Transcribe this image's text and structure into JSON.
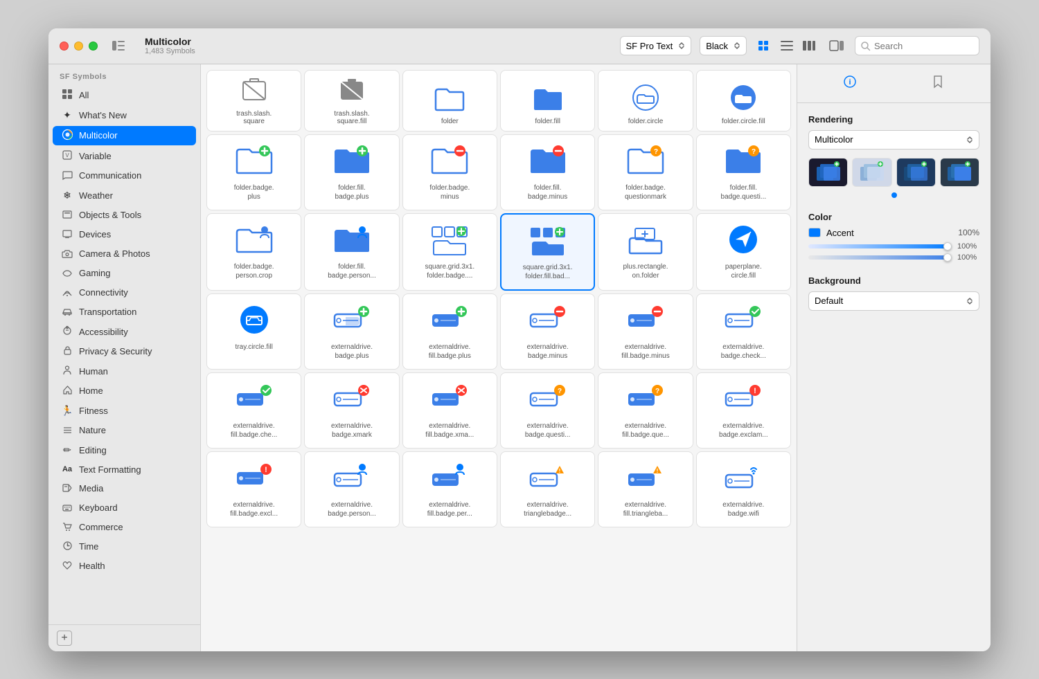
{
  "window": {
    "title": "Multicolor",
    "subtitle": "1,483 Symbols"
  },
  "toolbar": {
    "font": "SF Pro Text",
    "weight": "Black",
    "search_placeholder": "Search",
    "sidebar_toggle_label": "Toggle Sidebar"
  },
  "sidebar": {
    "header": "SF Symbols",
    "items": [
      {
        "id": "all",
        "label": "All",
        "icon": "⊞"
      },
      {
        "id": "whats-new",
        "label": "What's New",
        "icon": "✦"
      },
      {
        "id": "multicolor",
        "label": "Multicolor",
        "icon": "🌐",
        "active": true
      },
      {
        "id": "variable",
        "label": "Variable",
        "icon": "▣"
      },
      {
        "id": "communication",
        "label": "Communication",
        "icon": "💬"
      },
      {
        "id": "weather",
        "label": "Weather",
        "icon": "❄"
      },
      {
        "id": "objects-tools",
        "label": "Objects & Tools",
        "icon": "🗂"
      },
      {
        "id": "devices",
        "label": "Devices",
        "icon": "🖥"
      },
      {
        "id": "camera-photos",
        "label": "Camera & Photos",
        "icon": "📷"
      },
      {
        "id": "gaming",
        "label": "Gaming",
        "icon": "🎮"
      },
      {
        "id": "connectivity",
        "label": "Connectivity",
        "icon": "📡"
      },
      {
        "id": "transportation",
        "label": "Transportation",
        "icon": "🚗"
      },
      {
        "id": "accessibility",
        "label": "Accessibility",
        "icon": "♿"
      },
      {
        "id": "privacy-security",
        "label": "Privacy & Security",
        "icon": "🔒"
      },
      {
        "id": "human",
        "label": "Human",
        "icon": "👤"
      },
      {
        "id": "home",
        "label": "Home",
        "icon": "🏠"
      },
      {
        "id": "fitness",
        "label": "Fitness",
        "icon": "🏃"
      },
      {
        "id": "nature",
        "label": "Nature",
        "icon": "☰"
      },
      {
        "id": "editing",
        "label": "Editing",
        "icon": "✏"
      },
      {
        "id": "text-formatting",
        "label": "Text Formatting",
        "icon": "Aa"
      },
      {
        "id": "media",
        "label": "Media",
        "icon": "▶"
      },
      {
        "id": "keyboard",
        "label": "Keyboard",
        "icon": "⌨"
      },
      {
        "id": "commerce",
        "label": "Commerce",
        "icon": "🛒"
      },
      {
        "id": "time",
        "label": "Time",
        "icon": "🕐"
      },
      {
        "id": "health",
        "label": "Health",
        "icon": "❤"
      }
    ]
  },
  "top_row": [
    {
      "name": "trash.slash.\nsquare"
    },
    {
      "name": "trash.slash.\nsquare.fill"
    },
    {
      "name": "folder"
    },
    {
      "name": "folder.fill"
    },
    {
      "name": "folder.circle"
    },
    {
      "name": "folder.circle.fill"
    }
  ],
  "icon_rows": [
    [
      {
        "name": "folder.badge.\nplus",
        "badge": "plus",
        "badge_color": "#34C759"
      },
      {
        "name": "folder.fill.\nbadge.plus",
        "badge": "plus",
        "badge_color": "#34C759",
        "filled": true
      },
      {
        "name": "folder.badge.\nminus",
        "badge": "minus",
        "badge_color": "#FF3B30"
      },
      {
        "name": "folder.fill.\nbadge.minus",
        "badge": "minus",
        "badge_color": "#FF3B30",
        "filled": true
      },
      {
        "name": "folder.badge.\nquestionmark",
        "badge": "question",
        "badge_color": "#FF9500"
      },
      {
        "name": "folder.fill.\nbadge.questi...",
        "badge": "question",
        "badge_color": "#FF9500",
        "filled": true
      }
    ],
    [
      {
        "name": "folder.badge.\nperson.crop"
      },
      {
        "name": "folder.fill.\nbadge.person..."
      },
      {
        "name": "square.grid.3x1.\nfolder.badge....",
        "badge": "plus",
        "badge_color": "#34C759"
      },
      {
        "name": "square.grid.3x1.\nfolder.fill.bad...",
        "selected": true,
        "badge": "plus",
        "badge_color": "#34C759"
      },
      {
        "name": "plus.rectangle.\non.folder"
      },
      {
        "name": "paperplane.\ncircle.fill"
      }
    ],
    [
      {
        "name": "tray.circle.fill"
      },
      {
        "name": "externaldrive.\nbadge.plus",
        "badge": "plus",
        "badge_color": "#34C759"
      },
      {
        "name": "externaldrive.\nfill.badge.plus",
        "badge": "plus",
        "badge_color": "#34C759",
        "filled": true
      },
      {
        "name": "externaldrive.\nbadge.minus",
        "badge": "minus",
        "badge_color": "#FF3B30"
      },
      {
        "name": "externaldrive.\nfill.badge.minus",
        "badge": "minus",
        "badge_color": "#FF3B30",
        "filled": true
      },
      {
        "name": "externaldrive.\nbadge.check...",
        "badge": "check",
        "badge_color": "#34C759"
      }
    ],
    [
      {
        "name": "externaldrive.\nfill.badge.che...",
        "badge": "check",
        "badge_color": "#34C759",
        "filled": true
      },
      {
        "name": "externaldrive.\nbadge.xmark",
        "badge": "xmark",
        "badge_color": "#FF3B30"
      },
      {
        "name": "externaldrive.\nfill.badge.xma...",
        "badge": "xmark",
        "badge_color": "#FF3B30",
        "filled": true
      },
      {
        "name": "externaldrive.\nbadge.questi...",
        "badge": "question",
        "badge_color": "#FF9500"
      },
      {
        "name": "externaldrive.\nfill.badge.que...",
        "badge": "question",
        "badge_color": "#FF9500",
        "filled": true
      },
      {
        "name": "externaldrive.\nbadge.exclam...",
        "badge": "exclaim",
        "badge_color": "#FF3B30"
      }
    ],
    [
      {
        "name": "externaldrive.\nfill.badge.excl...",
        "badge": "exclaim",
        "badge_color": "#FF3B30",
        "filled": true
      },
      {
        "name": "externaldrive.\nbadge.person...",
        "badge": "person",
        "badge_color": "#007AFF"
      },
      {
        "name": "externaldrive.\nfill.badge.per...",
        "badge": "person",
        "badge_color": "#007AFF",
        "filled": true
      },
      {
        "name": "externaldrive.\ntrianglebadge...",
        "badge": "warning",
        "badge_color": "#FF9500"
      },
      {
        "name": "externaldrive.\nfill.triangleba...",
        "badge": "warning",
        "badge_color": "#FF9500",
        "filled": true
      },
      {
        "name": "externaldrive.\nbadge.wifi",
        "badge": "wifi",
        "badge_color": "#007AFF"
      }
    ]
  ],
  "inspector": {
    "rendering_label": "Rendering",
    "rendering_value": "Multicolor",
    "color_label": "Color",
    "color_accent": "Accent",
    "color_accent_value": "100%",
    "color_slider_value": "100%",
    "background_label": "Background",
    "background_value": "Default"
  }
}
